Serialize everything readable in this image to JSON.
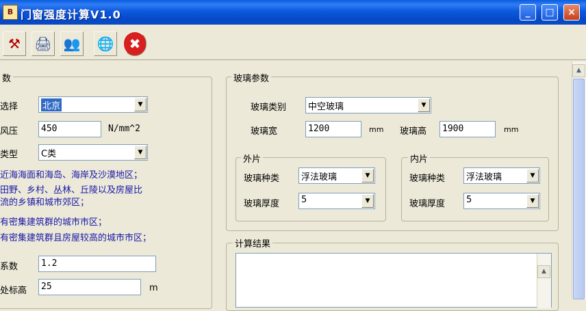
{
  "window": {
    "title": "门窗强度计算V1.0",
    "app_icon_text": "B",
    "minimize_glyph": "_",
    "maximize_glyph": "□",
    "close_glyph": "×"
  },
  "toolbar": {
    "buttons": [
      {
        "icon": "calculate-icon",
        "glyph": "⚒"
      },
      {
        "icon": "print-icon",
        "glyph": "🖨"
      },
      {
        "icon": "users-icon",
        "glyph": "👥"
      },
      {
        "icon": "globe-icon",
        "glyph": "🌐"
      },
      {
        "icon": "close-circle-icon",
        "glyph": "✖"
      }
    ]
  },
  "left_panel": {
    "legend": "数",
    "region_label": "选择",
    "region_value": "北京",
    "pressure_label": "风压",
    "pressure_value": "450",
    "pressure_unit": "N/mm^2",
    "terrain_label": "类型",
    "terrain_value": "C类",
    "desc_lines": [
      "近海海面和海岛、海岸及沙漠地区；",
      "田野、乡村、丛林、丘陵以及房屋比",
      "流的乡镇和城市郊区；",
      "有密集建筑群的城市市区；",
      "有密集建筑群且房屋较高的城市市区；"
    ],
    "coef_label": "系数",
    "coef_value": "1.2",
    "height_label": "处标高",
    "height_value": "25",
    "height_unit": "m"
  },
  "glass_params": {
    "legend": "玻璃参数",
    "type_label": "玻璃类别",
    "type_value": "中空玻璃",
    "width_label": "玻璃宽",
    "width_value": "1200",
    "width_unit": "mm",
    "height_label": "玻璃高",
    "height_value": "1900",
    "height_unit": "mm",
    "outer": {
      "legend": "外片",
      "kind_label": "玻璃种类",
      "kind_value": "浮法玻璃",
      "thick_label": "玻璃厚度",
      "thick_value": "5"
    },
    "inner": {
      "legend": "内片",
      "kind_label": "玻璃种类",
      "kind_value": "浮法玻璃",
      "thick_label": "玻璃厚度",
      "thick_value": "5"
    }
  },
  "results": {
    "legend": "计算结果"
  },
  "scroll": {
    "up_glyph": "▲"
  }
}
